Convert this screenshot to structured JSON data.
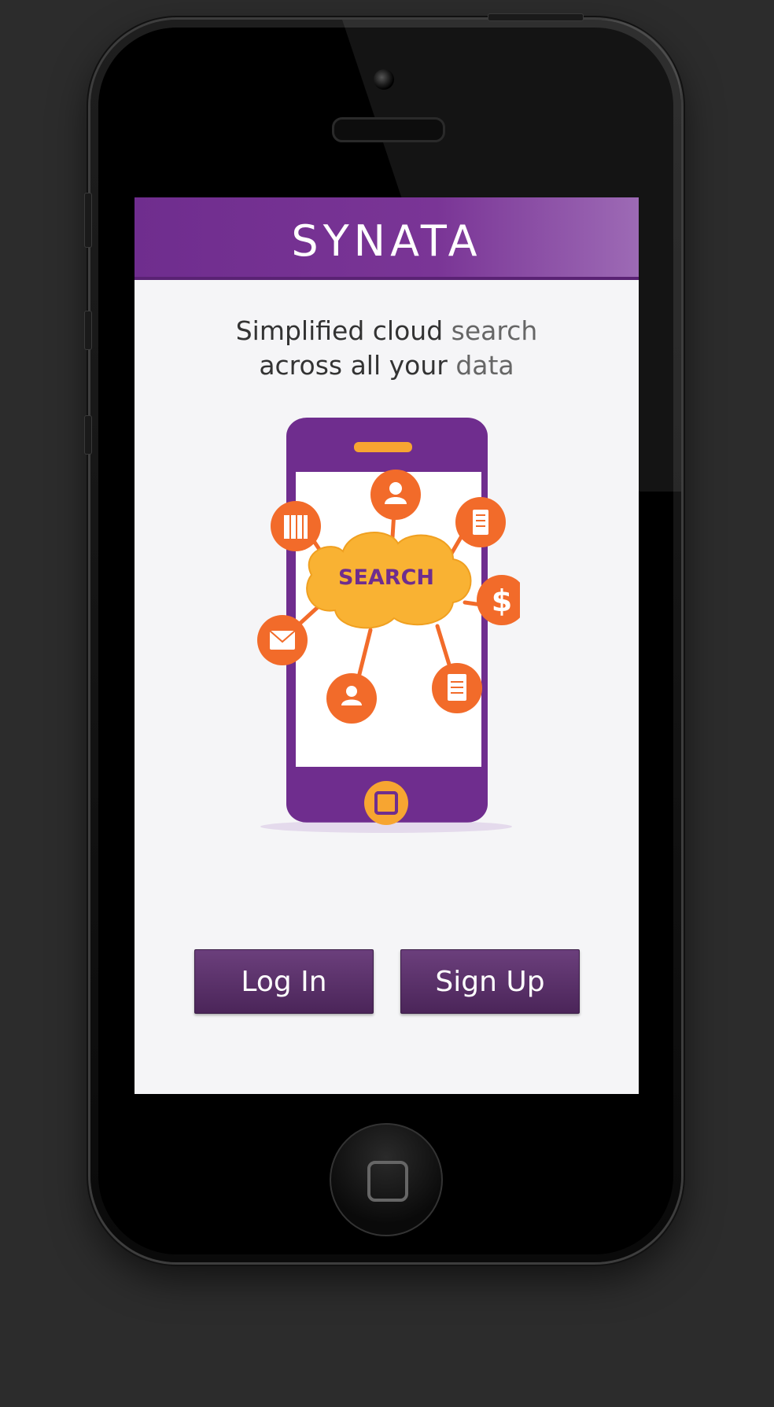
{
  "brand": {
    "logo_text": "SYNATA",
    "primary_color": "#6f2d8e",
    "accent_color": "#f7a531",
    "icon_color": "#f26b2a"
  },
  "hero": {
    "line1_a": "Simplified cloud ",
    "line1_b": "search",
    "line2_a": "across all your ",
    "line2_b": "data"
  },
  "illustration": {
    "center_label": "SEARCH",
    "icons": [
      "user-icon",
      "document-list-icon",
      "dollar-icon",
      "file-icon",
      "user-transfer-icon",
      "mail-icon",
      "building-icon"
    ]
  },
  "actions": {
    "login_label": "Log In",
    "signup_label": "Sign Up"
  }
}
